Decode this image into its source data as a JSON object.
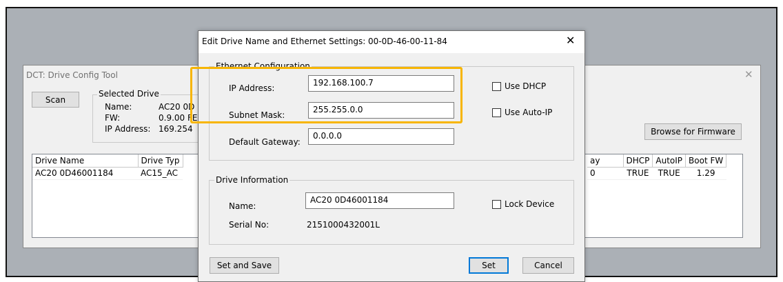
{
  "back_window": {
    "title": "DCT: Drive Config Tool",
    "close_glyph": "✕",
    "scan_label": "Scan",
    "selected_drive": {
      "group_label": "Selected Drive",
      "name_label": "Name:",
      "name_value": "AC20 0D",
      "fw_label": "FW:",
      "fw_value": "0.9.00 FE",
      "ip_label": "IP Address:",
      "ip_value": "169.254"
    },
    "browse_firmware_label": "Browse for Firmware",
    "table_left": {
      "columns": [
        "Drive Name",
        "Drive Typ"
      ],
      "rows": [
        [
          "AC20 0D46001184",
          "AC15_AC"
        ]
      ]
    },
    "table_right": {
      "columns": [
        "ay",
        "DHCP",
        "AutoIP",
        "Boot FW"
      ],
      "rows": [
        [
          "0",
          "TRUE",
          "TRUE",
          "1.29"
        ]
      ]
    }
  },
  "dialog": {
    "title": "Edit Drive Name and Ethernet Settings: 00-0D-46-00-11-84",
    "close_glyph": "✕",
    "ethernet": {
      "group_label": "Ethernet Configuration",
      "ip_label": "IP Address:",
      "ip_value": "192.168.100.7",
      "subnet_label": "Subnet Mask:",
      "subnet_value": "255.255.0.0",
      "gateway_label": "Default Gateway:",
      "gateway_value": "0.0.0.0",
      "use_dhcp_label": "Use DHCP",
      "use_auto_ip_label": "Use Auto-IP"
    },
    "drive_info": {
      "group_label": "Drive Information",
      "name_label": "Name:",
      "name_value": "AC20 0D46001184",
      "serial_label": "Serial No:",
      "serial_value": "2151000432001L",
      "lock_device_label": "Lock Device"
    },
    "buttons": {
      "set_and_save": "Set and Save",
      "set": "Set",
      "cancel": "Cancel"
    }
  },
  "highlight_color": "#f7b500"
}
